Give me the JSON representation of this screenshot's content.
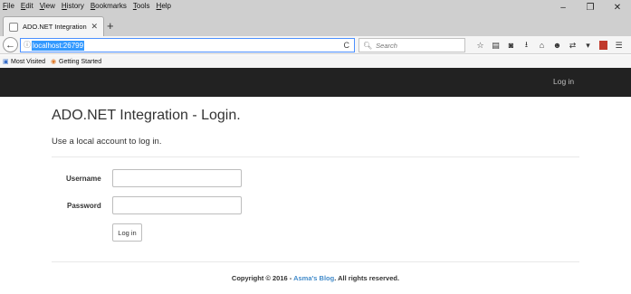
{
  "browser": {
    "menu": [
      "File",
      "Edit",
      "View",
      "History",
      "Bookmarks",
      "Tools",
      "Help"
    ],
    "window_controls": {
      "minimize": "–",
      "restore": "❐",
      "close": "✕"
    },
    "tab": {
      "title": "ADO.NET Integration - Lo...",
      "close": "✕"
    },
    "new_tab": "+",
    "back": "←",
    "url": "localhost:26799",
    "reload": "C",
    "search_placeholder": "Search",
    "toolbar_icons": [
      "star-icon",
      "clipboard-icon",
      "pocket-icon",
      "download-icon",
      "home-icon",
      "smiley-icon",
      "extension-icon",
      "menu-icon"
    ],
    "toolbar_glyphs": {
      "star": "☆",
      "clipboard": "▤",
      "pocket": "◙",
      "download": "⭳",
      "home": "⌂",
      "smiley": "☻",
      "ext": "⇄",
      "dropdown": "▾",
      "menu": "☰"
    },
    "bookmarks": [
      "Most Visited",
      "Getting Started"
    ],
    "colors": {
      "url_highlight": "#3399ff",
      "url_focus_border": "#4d90fe"
    }
  },
  "site": {
    "nav": {
      "login_label": "Log in",
      "background": "#222222"
    },
    "page_title": "ADO.NET Integration - Login.",
    "subtitle": "Use a local account to log in.",
    "form": {
      "username_label": "Username",
      "username_value": "",
      "password_label": "Password",
      "password_value": "",
      "submit_label": "Log in"
    },
    "footer": {
      "prefix": "Copyright © 2016 - ",
      "link": "Asma's Blog",
      "suffix": ". All rights reserved.",
      "link_color": "#428bca"
    }
  }
}
